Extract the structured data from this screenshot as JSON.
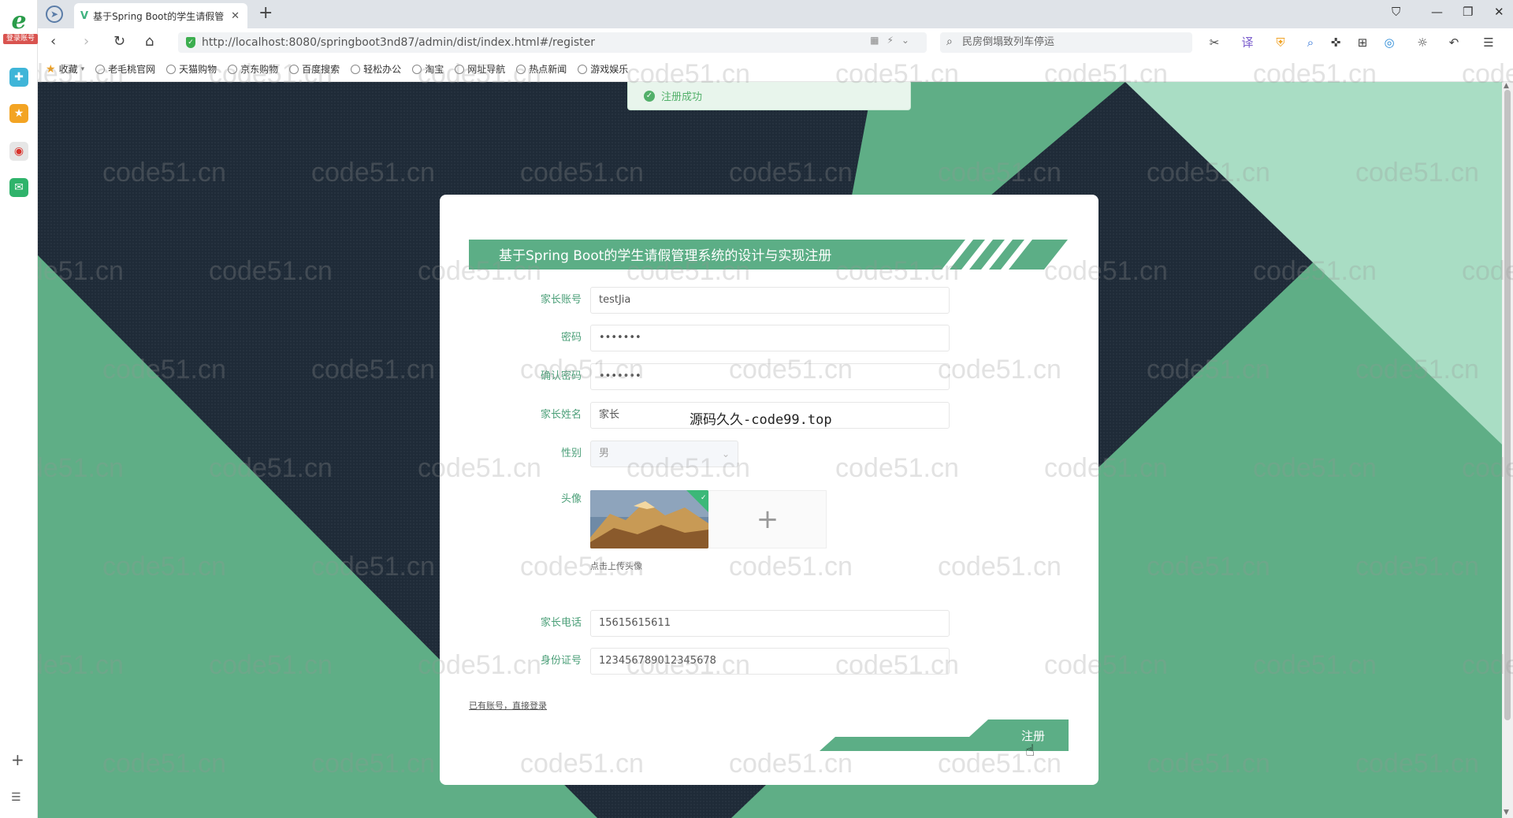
{
  "browser": {
    "sidebar_badge": "登录账号",
    "tab_title": "基于Spring Boot的学生请假管",
    "url": "http://localhost:8080/springboot3nd87/admin/dist/index.html#/register",
    "search_text": "民房倒塌致列车停运",
    "bookmarks": [
      "收藏",
      "老毛桃官网",
      "天猫购物",
      "京东购物",
      "百度搜索",
      "轻松办公",
      "淘宝",
      "网址导航",
      "热点新闻",
      "游戏娱乐"
    ]
  },
  "toast": {
    "message": "注册成功"
  },
  "form": {
    "title": "基于Spring Boot的学生请假管理系统的设计与实现注册",
    "fields": [
      {
        "label": "家长账号",
        "value": "testJia"
      },
      {
        "label": "密码",
        "value": "•••••••"
      },
      {
        "label": "确认密码",
        "value": "•••••••"
      },
      {
        "label": "家长姓名",
        "value": "家长"
      },
      {
        "label": "性别",
        "value": "男"
      },
      {
        "label": "家长电话",
        "value": "15615615611"
      },
      {
        "label": "身份证号",
        "value": "123456789012345678"
      }
    ],
    "avatar_label": "头像",
    "avatar_hint": "点击上传头像",
    "login_link": "已有账号，直接登录",
    "submit_label": "注册"
  },
  "overlay_text": "源码久久-code99.top",
  "watermark_text": "code51.cn",
  "colors": {
    "accent": "#5cae86",
    "accent_light": "#a8dcc3",
    "dark_bg": "#1f2b38"
  }
}
